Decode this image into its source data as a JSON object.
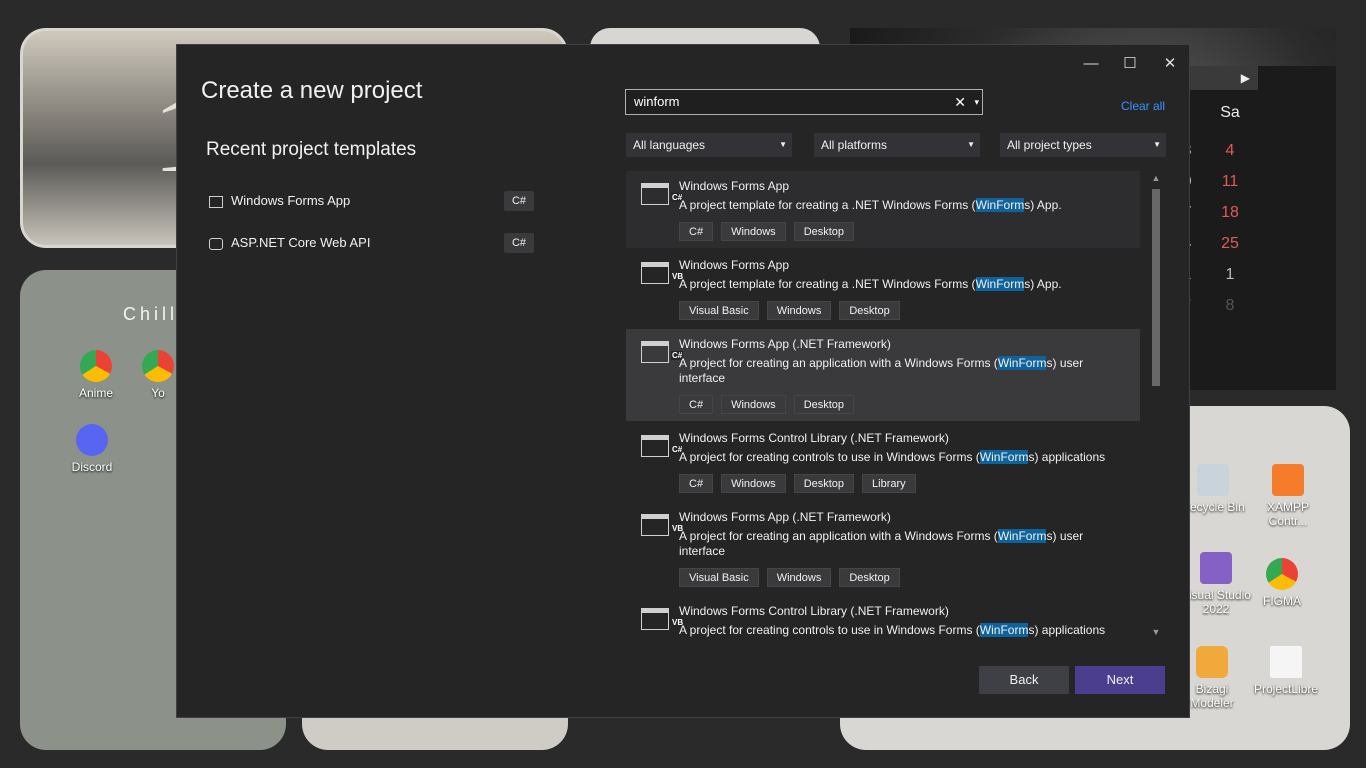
{
  "desktop": {
    "widget_number": "1",
    "widget_chill": "Chill",
    "icons_left": [
      {
        "label": "Anime"
      },
      {
        "label": "Yo"
      },
      {
        "label": "Discord"
      }
    ],
    "icons_right": [
      {
        "label": "Recycle Bin"
      },
      {
        "label": "XAMPP Contr..."
      },
      {
        "label": "Visual Studio 2022"
      },
      {
        "label": "FIGMA"
      },
      {
        "label": "Bizagi Modeler"
      },
      {
        "label": "ProjectLibre"
      }
    ],
    "calendar": {
      "headers": [
        "r",
        "Sa"
      ],
      "rows": [
        [
          "3",
          "4"
        ],
        [
          "0",
          "11"
        ],
        [
          "7",
          "18"
        ],
        [
          "4",
          "25"
        ],
        [
          "1",
          "1"
        ],
        [
          "7",
          "8"
        ]
      ]
    }
  },
  "dialog": {
    "title": "Create a new project",
    "recent_heading": "Recent project templates",
    "recent": [
      {
        "name": "Windows Forms App",
        "lang": "C#",
        "icon": "form-icon"
      },
      {
        "name": "ASP.NET Core Web API",
        "lang": "C#",
        "icon": "web-api-icon"
      }
    ],
    "window_controls": {
      "minimize": "—",
      "maximize": "☐",
      "close": "✕"
    },
    "search": {
      "value": "winform",
      "clear_glyph": "✕",
      "dropdown_glyph": "▾"
    },
    "clear_all": "Clear all",
    "filters": {
      "language": "All languages",
      "platform": "All platforms",
      "type": "All project types",
      "arrow": "▼"
    },
    "templates": [
      {
        "name": "Windows Forms App",
        "lang": "C#",
        "desc_before": "A project template for creating a .NET Windows Forms (",
        "desc_hl": "WinForm",
        "desc_after": "s) App.",
        "tags": [
          "C#",
          "Windows",
          "Desktop"
        ],
        "selected": false
      },
      {
        "name": "Windows Forms App",
        "lang": "VB",
        "desc_before": "A project template for creating a .NET Windows Forms (",
        "desc_hl": "WinForm",
        "desc_after": "s) App.",
        "tags": [
          "Visual Basic",
          "Windows",
          "Desktop"
        ],
        "selected": false
      },
      {
        "name": "Windows Forms App (.NET Framework)",
        "lang": "C#",
        "desc_before": "A project for creating an application with a Windows Forms (",
        "desc_hl": "WinForm",
        "desc_after": "s) user interface",
        "tags": [
          "C#",
          "Windows",
          "Desktop"
        ],
        "selected": true
      },
      {
        "name": "Windows Forms Control Library (.NET Framework)",
        "lang": "C#",
        "desc_before": "A project for creating controls to use in Windows Forms (",
        "desc_hl": "WinForm",
        "desc_after": "s) applications",
        "tags": [
          "C#",
          "Windows",
          "Desktop",
          "Library"
        ],
        "selected": false
      },
      {
        "name": "Windows Forms App (.NET Framework)",
        "lang": "VB",
        "desc_before": "A project for creating an application with a Windows Forms (",
        "desc_hl": "WinForm",
        "desc_after": "s) user interface",
        "tags": [
          "Visual Basic",
          "Windows",
          "Desktop"
        ],
        "selected": false
      },
      {
        "name": "Windows Forms Control Library (.NET Framework)",
        "lang": "VB",
        "desc_before": "A project for creating controls to use in Windows Forms (",
        "desc_hl": "WinForm",
        "desc_after": "s) applications",
        "tags": [],
        "selected": false
      }
    ],
    "scroll": {
      "up": "▲",
      "down": "▼"
    },
    "back_button": "Back",
    "next_button": "Next",
    "colors": {
      "accent": "#4b3e8e",
      "highlight": "#0e639c",
      "link": "#3794ff"
    }
  }
}
